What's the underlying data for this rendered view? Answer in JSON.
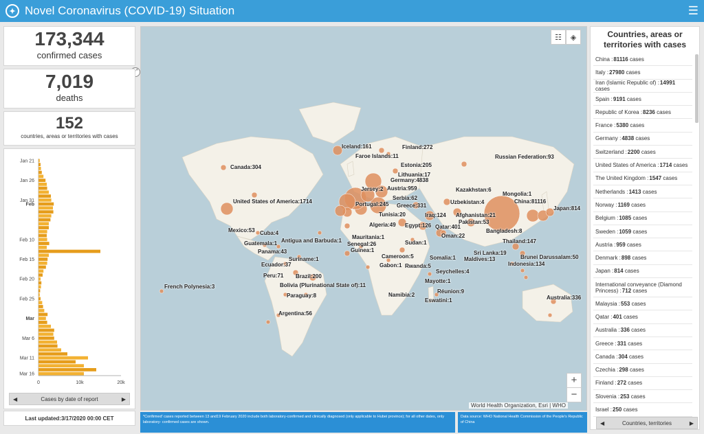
{
  "header": {
    "title": "Novel Coronavirus (COVID-19) Situation",
    "logo_icon": "who-logo-icon",
    "menu_icon": "hamburger-menu-icon"
  },
  "stats": {
    "confirmed": {
      "value": "173,344",
      "label": "confirmed cases"
    },
    "deaths": {
      "value": "7,019",
      "label": "deaths"
    },
    "countries": {
      "value": "152",
      "label": "countries, areas or territories with cases"
    }
  },
  "chart_data": {
    "type": "bar",
    "orientation": "horizontal",
    "stacked": true,
    "categories_label": "date",
    "y_tick_labels": [
      "Jan 21",
      "Jan 26",
      "Jan 31",
      "Feb",
      "Feb 10",
      "Feb 15",
      "Feb 20",
      "Feb 25",
      "Mar",
      "Mar 6",
      "Mar 11",
      "Mar 16"
    ],
    "x_tick_labels": [
      "0",
      "10k",
      "20k"
    ],
    "xlim": [
      0,
      20000
    ],
    "series_colors": [
      "#f3b233",
      "#e69d1c"
    ],
    "values": [
      300,
      500,
      600,
      800,
      1200,
      1700,
      2000,
      2100,
      2500,
      3000,
      3100,
      3700,
      3500,
      3600,
      3100,
      2900,
      2500,
      2500,
      2100,
      2000,
      2100,
      2600,
      2000,
      15000,
      2500,
      2200,
      2100,
      1800,
      1200,
      1000,
      500,
      700,
      600,
      400,
      300,
      500,
      900,
      1100,
      1400,
      2200,
      1800,
      2100,
      3000,
      3800,
      3600,
      3800,
      4500,
      4600,
      5500,
      7000,
      12000,
      9000,
      11000,
      14000,
      11000
    ]
  },
  "chart_footer": {
    "label": "Cases by date of report"
  },
  "last_updated": "Last updated:3/17/2020 00:00 CET",
  "map": {
    "attribution": "World Health Organization, Esri | WHO",
    "bubble_color": "#de8f5e",
    "labels": [
      {
        "text": "Iceland:161"
      },
      {
        "text": "Finland:272"
      },
      {
        "text": "Faroe Islands:11"
      },
      {
        "text": "Russian Federation:93"
      },
      {
        "text": "Canada:304"
      },
      {
        "text": "Estonia:205"
      },
      {
        "text": "Lithuania:17"
      },
      {
        "text": "Germany:4838"
      },
      {
        "text": "Jersey:2"
      },
      {
        "text": "Austria:959"
      },
      {
        "text": "Kazakhstan:6"
      },
      {
        "text": "Mongolia:1"
      },
      {
        "text": "Serbia:62"
      },
      {
        "text": "United States of America:1714"
      },
      {
        "text": "Portugal:245"
      },
      {
        "text": "Greece:331"
      },
      {
        "text": "Uzbekistan:4"
      },
      {
        "text": "China:81116"
      },
      {
        "text": "Japan:814"
      },
      {
        "text": "Tunisia:20"
      },
      {
        "text": "Iraq:124"
      },
      {
        "text": "Afghanistan:21"
      },
      {
        "text": "Pakistan:53"
      },
      {
        "text": "Mexico:53"
      },
      {
        "text": "Algeria:49"
      },
      {
        "text": "Egypt:126"
      },
      {
        "text": "Qatar:401"
      },
      {
        "text": "Bangladesh:8"
      },
      {
        "text": "Cuba:4"
      },
      {
        "text": "Mauritania:1"
      },
      {
        "text": "Oman:22"
      },
      {
        "text": "Antigua and Barbuda:1"
      },
      {
        "text": "Guatemala:1"
      },
      {
        "text": "Senegal:26"
      },
      {
        "text": "Sudan:1"
      },
      {
        "text": "Thailand:147"
      },
      {
        "text": "Panama:43"
      },
      {
        "text": "Guinea:1"
      },
      {
        "text": "Sri Lanka:19"
      },
      {
        "text": "Suriname:1"
      },
      {
        "text": "Cameroon:5"
      },
      {
        "text": "Somalia:1"
      },
      {
        "text": "Maldives:13"
      },
      {
        "text": "Brunei Darussalam:50"
      },
      {
        "text": "Ecuador:37"
      },
      {
        "text": "Gabon:1"
      },
      {
        "text": "Rwanda:5"
      },
      {
        "text": "Indonesia:134"
      },
      {
        "text": "French Polynesia:3"
      },
      {
        "text": "Peru:71"
      },
      {
        "text": "Brazil:200"
      },
      {
        "text": "Seychelles:4"
      },
      {
        "text": "Bolivia (Plurinational State of):11"
      },
      {
        "text": "Mayotte:1"
      },
      {
        "text": "Paraguay:8"
      },
      {
        "text": "Réunion:9"
      },
      {
        "text": "Namibia:2"
      },
      {
        "text": "Eswatini:1"
      },
      {
        "text": "Australia:336"
      },
      {
        "text": "Argentina:56"
      }
    ]
  },
  "note": "*Confirmed' cases reported between 13 and19 February 2020 include both laboratory-confirmed and clinically diagnosed (only applicable to Hubei province); for all other dates, only laboratory- confirmed cases are shown.",
  "source": "Data source: WHO National Health Commission of the People's Republic of China",
  "list": {
    "title": "Countries, areas or territories with cases",
    "footer": "Countries, territories",
    "items": [
      {
        "name": "China :",
        "cases": "81116",
        "suffix": " cases"
      },
      {
        "name": "Italy :",
        "cases": "27980",
        "suffix": " cases"
      },
      {
        "name": "Iran (Islamic Republic of) :",
        "cases": "14991",
        "suffix": " cases"
      },
      {
        "name": "Spain :",
        "cases": "9191",
        "suffix": " cases"
      },
      {
        "name": "Republic of Korea :",
        "cases": "8236",
        "suffix": " cases"
      },
      {
        "name": "France :",
        "cases": "5380",
        "suffix": " cases"
      },
      {
        "name": "Germany :",
        "cases": "4838",
        "suffix": " cases"
      },
      {
        "name": "Switzerland :",
        "cases": "2200",
        "suffix": " cases"
      },
      {
        "name": "United States of America :",
        "cases": "1714",
        "suffix": " cases"
      },
      {
        "name": "The United Kingdom :",
        "cases": "1547",
        "suffix": " cases"
      },
      {
        "name": "Netherlands :",
        "cases": "1413",
        "suffix": " cases"
      },
      {
        "name": "Norway :",
        "cases": "1169",
        "suffix": " cases"
      },
      {
        "name": "Belgium :",
        "cases": "1085",
        "suffix": " cases"
      },
      {
        "name": "Sweden :",
        "cases": "1059",
        "suffix": " cases"
      },
      {
        "name": "Austria :",
        "cases": "959",
        "suffix": " cases"
      },
      {
        "name": "Denmark :",
        "cases": "898",
        "suffix": " cases"
      },
      {
        "name": "Japan :",
        "cases": "814",
        "suffix": " cases"
      },
      {
        "name": "International conveyance (Diamond Princess) :",
        "cases": "712",
        "suffix": " cases"
      },
      {
        "name": "Malaysia :",
        "cases": "553",
        "suffix": " cases"
      },
      {
        "name": "Qatar :",
        "cases": "401",
        "suffix": " cases"
      },
      {
        "name": "Australia :",
        "cases": "336",
        "suffix": " cases"
      },
      {
        "name": "Greece :",
        "cases": "331",
        "suffix": " cases"
      },
      {
        "name": "Canada :",
        "cases": "304",
        "suffix": " cases"
      },
      {
        "name": "Czechia :",
        "cases": "298",
        "suffix": " cases"
      },
      {
        "name": "Finland :",
        "cases": "272",
        "suffix": " cases"
      },
      {
        "name": "Slovenia :",
        "cases": "253",
        "suffix": " cases"
      },
      {
        "name": "Israel :",
        "cases": "250",
        "suffix": " cases"
      }
    ]
  }
}
